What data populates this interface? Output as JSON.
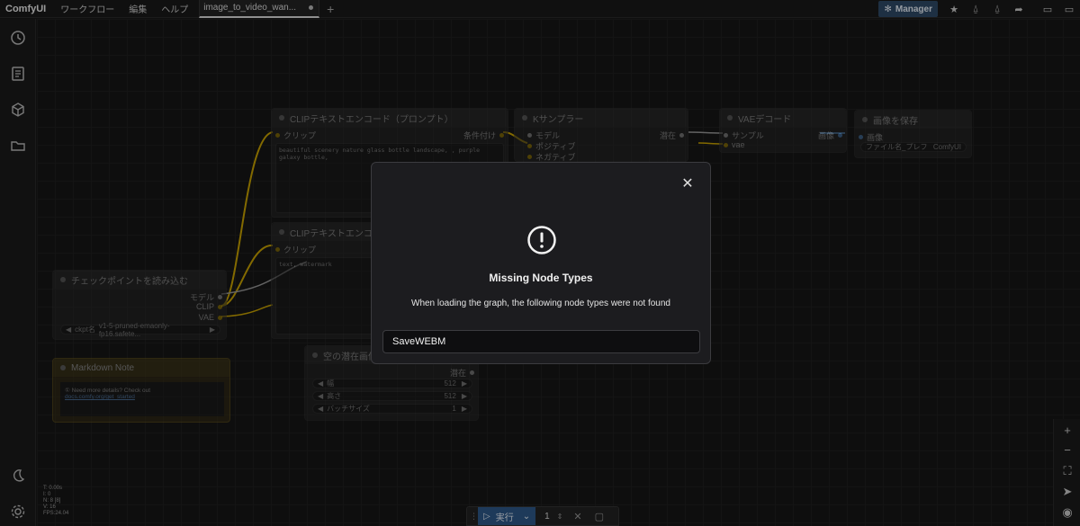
{
  "app": {
    "brand": "ComfyUI",
    "menu": [
      "ワークフロー",
      "編集",
      "ヘルプ"
    ],
    "tab": {
      "label": "image_to_video_wan..."
    },
    "manager_label": "Manager"
  },
  "nodes": {
    "clip_pos": {
      "title": "CLIPテキストエンコード（プロンプト）",
      "in_clip": "クリップ",
      "out": "条件付け",
      "text": "beautiful scenery nature glass bottle landscape, , purple galaxy bottle,"
    },
    "clip_neg": {
      "title": "CLIPテキストエンコード（プロンプト）",
      "in_clip": "クリップ",
      "text": "text, watermark"
    },
    "ksampler": {
      "title": "Kサンプラー",
      "in_model": "モデル",
      "in_pos": "ポジティブ",
      "in_neg": "ネガティブ",
      "out": "潜在"
    },
    "vae_decode": {
      "title": "VAEデコード",
      "in_samples": "サンプル",
      "in_vae": "vae",
      "out": "画像"
    },
    "save_image": {
      "title": "画像を保存",
      "in_images": "画像",
      "prefix_label": "ファイル名_プレフ",
      "prefix_value": "ComfyUI"
    },
    "checkpoint": {
      "title": "チェックポイントを読み込む",
      "out_model": "モデル",
      "out_clip": "CLIP",
      "out_vae": "VAE",
      "ckpt_label": "ckpt名",
      "ckpt_value": "v1-5-pruned-emaonly-fp16.safete..."
    },
    "note": {
      "title": "Markdown Note",
      "text_prefix": "① Need more details? Check out ",
      "link": "docs.comfy.org/get_started"
    },
    "latent": {
      "title": "空の潜在画像",
      "out": "潜在",
      "w_label": "幅",
      "w_value": "512",
      "h_label": "高さ",
      "h_value": "512",
      "b_label": "バッチサイズ",
      "b_value": "1"
    }
  },
  "stats": [
    "T: 0.00s",
    "I: 0",
    "N: 8 [8]",
    "V: 16",
    "FPS:24.04"
  ],
  "runbar": {
    "run_label": "実行",
    "count": "1"
  },
  "modal": {
    "title": "Missing Node Types",
    "message": "When loading the graph, the following node types were not found",
    "missing": [
      "SaveWEBM"
    ]
  },
  "icons": {
    "sidebar": [
      "history-icon",
      "book-icon",
      "cube-icon",
      "folder-open-icon",
      "moon-icon",
      "gear-icon"
    ],
    "right": [
      "zoom-in-icon",
      "zoom-out-icon",
      "fit-view-icon",
      "select-cursor-icon",
      "eye-icon"
    ]
  },
  "colors": {
    "accent": "#2f5a8a",
    "clip_wire": "#c9a300",
    "modal_bg": "#1c1c1f"
  }
}
